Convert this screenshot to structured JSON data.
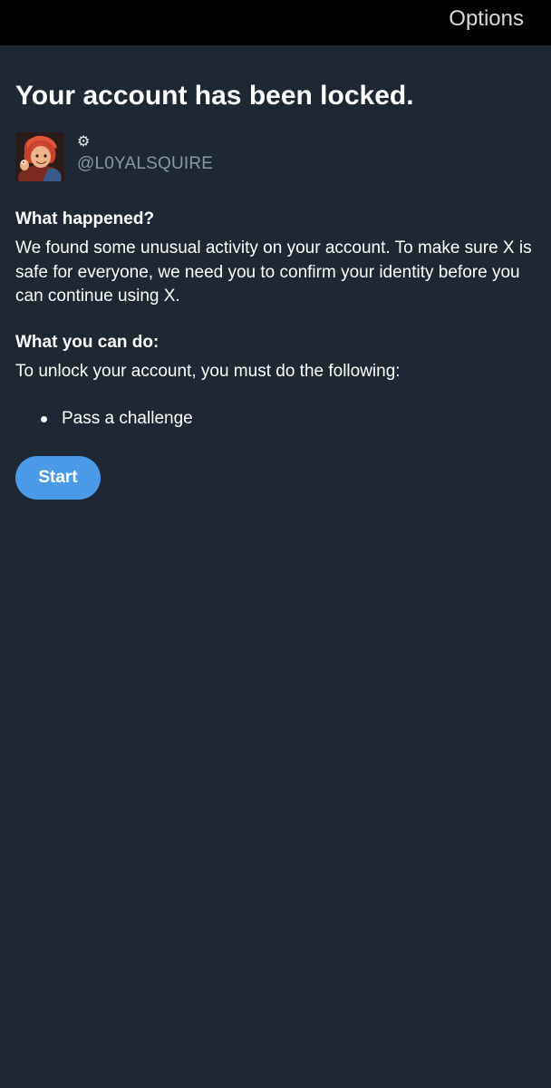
{
  "header": {
    "options_label": "Options"
  },
  "page": {
    "title": "Your account has been locked."
  },
  "account": {
    "name_icon": "gear-icon",
    "name_glyph": "⚙",
    "handle": "@L0YALSQUIRE"
  },
  "what_happened": {
    "heading": "What happened?",
    "body": "We found some unusual activity on your account. To make sure X is safe for everyone, we need you to confirm your identity before you can continue using X."
  },
  "what_you_can_do": {
    "heading": "What you can do:",
    "body": "To unlock your account, you must do the following:",
    "items": [
      {
        "label": "Pass a challenge"
      }
    ]
  },
  "actions": {
    "start_label": "Start"
  },
  "colors": {
    "background": "#1e2734",
    "topbar": "#000000",
    "accent": "#4a9ae8",
    "secondary_text": "#8899a6"
  }
}
